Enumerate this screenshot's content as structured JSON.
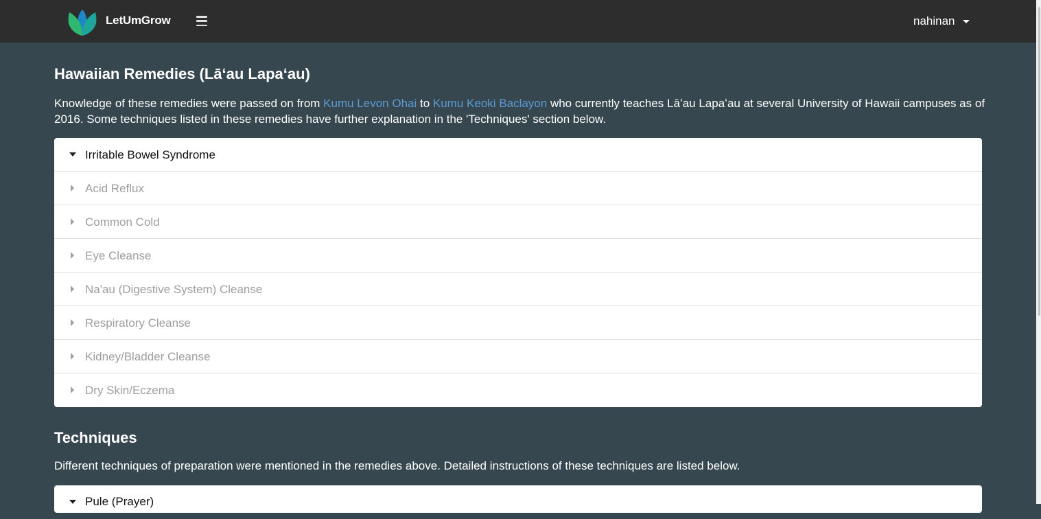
{
  "navbar": {
    "brand": "LetUmGrow",
    "menu_icon": "hamburger-menu-icon",
    "user": "nahinan"
  },
  "remedies": {
    "title": "Hawaiian Remedies (Lāʻau Lapaʻau)",
    "intro_1": "Knowledge of these remedies were passed on from ",
    "link_1": "Kumu Levon Ohai",
    "intro_2": " to ",
    "link_2": "Kumu Keoki Baclayon",
    "intro_3": " who currently teaches Lāʻau Lapaʻau at several University of Hawaii campuses as of 2016. Some techniques listed in these remedies have further explanation in the 'Techniques' section below.",
    "items": [
      {
        "label": "Irritable Bowel Syndrome",
        "expanded": true
      },
      {
        "label": "Acid Reflux",
        "expanded": false
      },
      {
        "label": "Common Cold",
        "expanded": false
      },
      {
        "label": "Eye Cleanse",
        "expanded": false
      },
      {
        "label": "Na'au (Digestive System) Cleanse",
        "expanded": false
      },
      {
        "label": "Respiratory Cleanse",
        "expanded": false
      },
      {
        "label": "Kidney/Bladder Cleanse",
        "expanded": false
      },
      {
        "label": "Dry Skin/Eczema",
        "expanded": false
      }
    ]
  },
  "techniques": {
    "title": "Techniques",
    "intro": "Different techniques of preparation were mentioned in the remedies above. Detailed instructions of these techniques are listed below.",
    "items": [
      {
        "label": "Pule (Prayer)",
        "expanded": true
      }
    ]
  },
  "colors": {
    "background": "#37474f",
    "navbar": "#2d2d2d",
    "link": "#5b9bd5",
    "logo_green": "#2eb872",
    "logo_teal": "#1fa59a",
    "logo_blue": "#1e88c7"
  }
}
